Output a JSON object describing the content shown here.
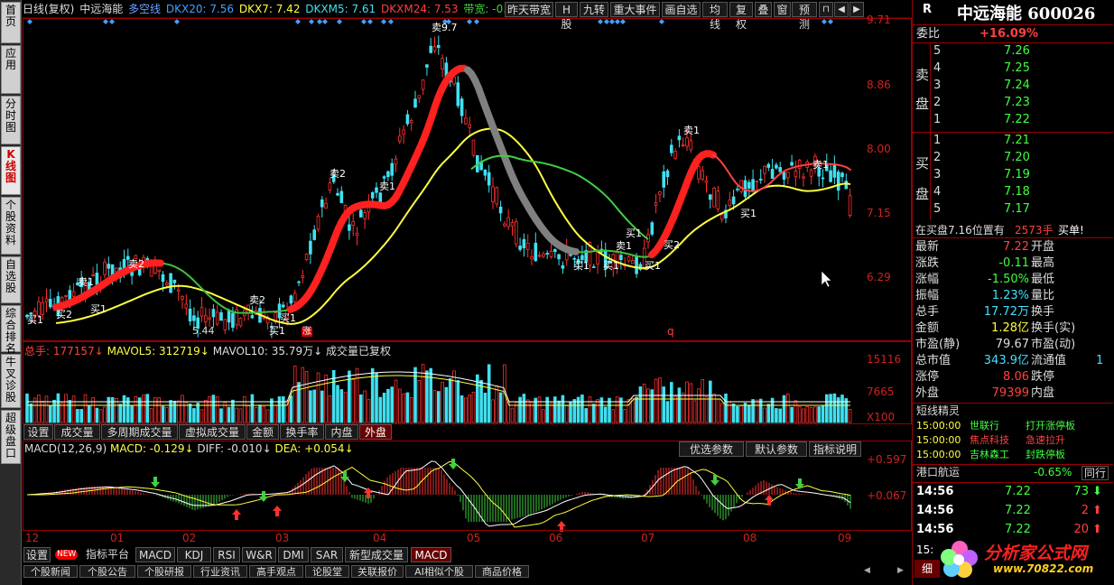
{
  "side_tabs": [
    {
      "label": "首页",
      "active": false
    },
    {
      "label": "应用",
      "active": false
    },
    {
      "label": "分时图",
      "active": false
    },
    {
      "label": "K线图",
      "active": true
    },
    {
      "label": "个股资料",
      "active": false
    },
    {
      "label": "自选股",
      "active": false
    },
    {
      "label": "综合排名",
      "active": false
    },
    {
      "label": "牛叉诊股",
      "active": false
    },
    {
      "label": "超级盘口",
      "active": false
    }
  ],
  "header": {
    "period": "日线(复权)",
    "name": "中远海能",
    "indicator": "多空线",
    "dkx20": "DKX20: 7.56",
    "dkx7": "DKX7: 7.42",
    "dkxm5": "DKXM5: 7.61",
    "dkxm24": "DKXM24: 7.53",
    "band": "带宽: -0.11",
    "band_arrow": "↓"
  },
  "toolbar": [
    "昨天带宽",
    "H股",
    "九转",
    "重大事件",
    "画自选",
    "均线",
    "复权",
    "叠",
    "窗",
    "预测"
  ],
  "toolbar_icons": [
    "pin-icon",
    "arrow-left-icon",
    "arrow-right-icon"
  ],
  "main_axis": [
    "9.71",
    "8.86",
    "8.00",
    "7.15",
    "6.29"
  ],
  "chart_annotations": {
    "peak": "卖9.7",
    "low": "5.44",
    "zhang": "涨",
    "q": "q"
  },
  "volume": {
    "label": "总手: 177157",
    "mavol5": "MAVOL5: 312719",
    "mavol10": "MAVOL10: 35.79万",
    "note": "成交量已复权",
    "axis": [
      "15116",
      "7665",
      "X100"
    ]
  },
  "vol_tabs": [
    "设置",
    "成交量",
    "多周期成交量",
    "虚拟成交量",
    "金额",
    "换手率",
    "内盘",
    "外盘"
  ],
  "vol_active": "外盘",
  "macd": {
    "label": "MACD(12,26,9)",
    "macd": "MACD: -0.129",
    "diff": "DIFF: -0.010",
    "dea": "DEA: +0.054",
    "axis": [
      "+0.597",
      "+0.067"
    ],
    "buttons": [
      "优选参数",
      "默认参数",
      "指标说明"
    ]
  },
  "date_axis": [
    "12",
    "01",
    "02",
    "03",
    "04",
    "05",
    "06",
    "07",
    "08",
    "09"
  ],
  "bottom_tabs": [
    "设置",
    "指标平台",
    "MACD",
    "KDJ",
    "RSI",
    "W&R",
    "DMI",
    "SAR",
    "新型成交量",
    "MACD"
  ],
  "bottom_new": "NEW",
  "bottom_tabs2": [
    "个股新闻",
    "个股公告",
    "个股研报",
    "行业资讯",
    "高手观点",
    "论股堂",
    "关联报价",
    "AI相似个股",
    "商品价格"
  ],
  "quote": {
    "market": "R",
    "name": "中远海能",
    "code": "600026",
    "weibi_label": "委比",
    "weibi": "+16.09%",
    "sell_label": "卖\n\n盘",
    "buy_label": "买\n\n盘",
    "sells": [
      {
        "lvl": "5",
        "price": "7.26"
      },
      {
        "lvl": "4",
        "price": "7.25"
      },
      {
        "lvl": "3",
        "price": "7.24"
      },
      {
        "lvl": "2",
        "price": "7.23"
      },
      {
        "lvl": "1",
        "price": "7.22"
      }
    ],
    "buys": [
      {
        "lvl": "1",
        "price": "7.21"
      },
      {
        "lvl": "2",
        "price": "7.20"
      },
      {
        "lvl": "3",
        "price": "7.19"
      },
      {
        "lvl": "4",
        "price": "7.18"
      },
      {
        "lvl": "5",
        "price": "7.17"
      }
    ],
    "notice": "在买盘7.16位置有",
    "notice_vol": "2573手",
    "notice_tag": "买单!",
    "stats": [
      [
        "最新",
        "7.22",
        "开盘",
        ""
      ],
      [
        "涨跌",
        "-0.11",
        "最高",
        ""
      ],
      [
        "涨幅",
        "-1.50%",
        "最低",
        ""
      ],
      [
        "振幅",
        "1.23%",
        "量比",
        ""
      ],
      [
        "总手",
        "17.72万",
        "换手",
        ""
      ],
      [
        "金额",
        "1.28亿",
        "换手(实)",
        ""
      ],
      [
        "市盈(静)",
        "79.67",
        "市盈(动)",
        ""
      ],
      [
        "总市值",
        "343.9亿",
        "流通值",
        "1"
      ],
      [
        "涨停",
        "8.06",
        "跌停",
        ""
      ],
      [
        "外盘",
        "79399",
        "内盘",
        ""
      ]
    ],
    "genie_title": "短线精灵",
    "genie": [
      {
        "time": "15:00:00",
        "stock": "世联行",
        "event": "打开涨停板"
      },
      {
        "time": "15:00:00",
        "stock": "焦点科技",
        "event": "急速拉升"
      },
      {
        "time": "15:00:00",
        "stock": "吉林森工",
        "event": "封跌停板"
      }
    ],
    "sector": "港口航运",
    "sector_chg": "-0.65%",
    "sector_btn": "同行",
    "ticks": [
      {
        "time": "14:56",
        "price": "7.22",
        "vol": "73",
        "dir": "down"
      },
      {
        "time": "14:56",
        "price": "7.22",
        "vol": "2",
        "dir": "up"
      },
      {
        "time": "14:56",
        "price": "7.22",
        "vol": "20",
        "dir": "up"
      }
    ],
    "tick_partial": "15:",
    "tab_bottom": "细"
  },
  "watermark": {
    "title": "分析家公式网",
    "url": "www.70822.com"
  },
  "colors": {
    "up": "#ff3030",
    "down": "#40e0f0",
    "frame": "#990000",
    "yellow": "#ffff40",
    "green": "#40d040"
  }
}
